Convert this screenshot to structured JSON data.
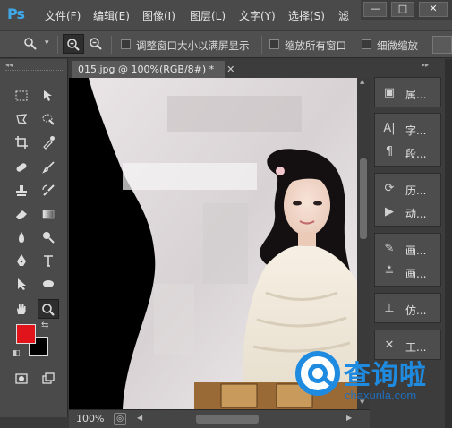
{
  "app": {
    "logo": "Ps"
  },
  "menu": [
    "文件(F)",
    "编辑(E)",
    "图像(I)",
    "图层(L)",
    "文字(Y)",
    "选择(S)",
    "滤"
  ],
  "window_controls": [
    "—",
    "□",
    "✕"
  ],
  "options_bar": {
    "zoom_in_icon": "zoom-in-icon",
    "zoom_out_icon": "zoom-out-icon",
    "checkboxes": [
      {
        "label": "调整窗口大小以满屏显示",
        "checked": false
      },
      {
        "label": "缩放所有窗口",
        "checked": false
      },
      {
        "label": "细微缩放",
        "checked": false
      }
    ]
  },
  "document": {
    "tab_title": "015.jpg @ 100%(RGB/8#) *",
    "zoom": "100%"
  },
  "colors": {
    "foreground": "#e2141b",
    "background": "#000000"
  },
  "dock": {
    "groups": [
      [
        {
          "icon": "▣",
          "label": "属..."
        }
      ],
      [
        {
          "icon": "A|",
          "label": "字..."
        },
        {
          "icon": "¶",
          "label": "段..."
        }
      ],
      [
        {
          "icon": "⟳",
          "label": "历..."
        },
        {
          "icon": "▶",
          "label": "动..."
        }
      ],
      [
        {
          "icon": "✎",
          "label": "画..."
        },
        {
          "icon": "≛",
          "label": "画..."
        }
      ],
      [
        {
          "icon": "⊥",
          "label": "仿..."
        }
      ],
      [
        {
          "icon": "✕",
          "label": "工..."
        }
      ]
    ]
  },
  "watermark": {
    "brand": "查询啦",
    "url": "chaxunla.com"
  }
}
